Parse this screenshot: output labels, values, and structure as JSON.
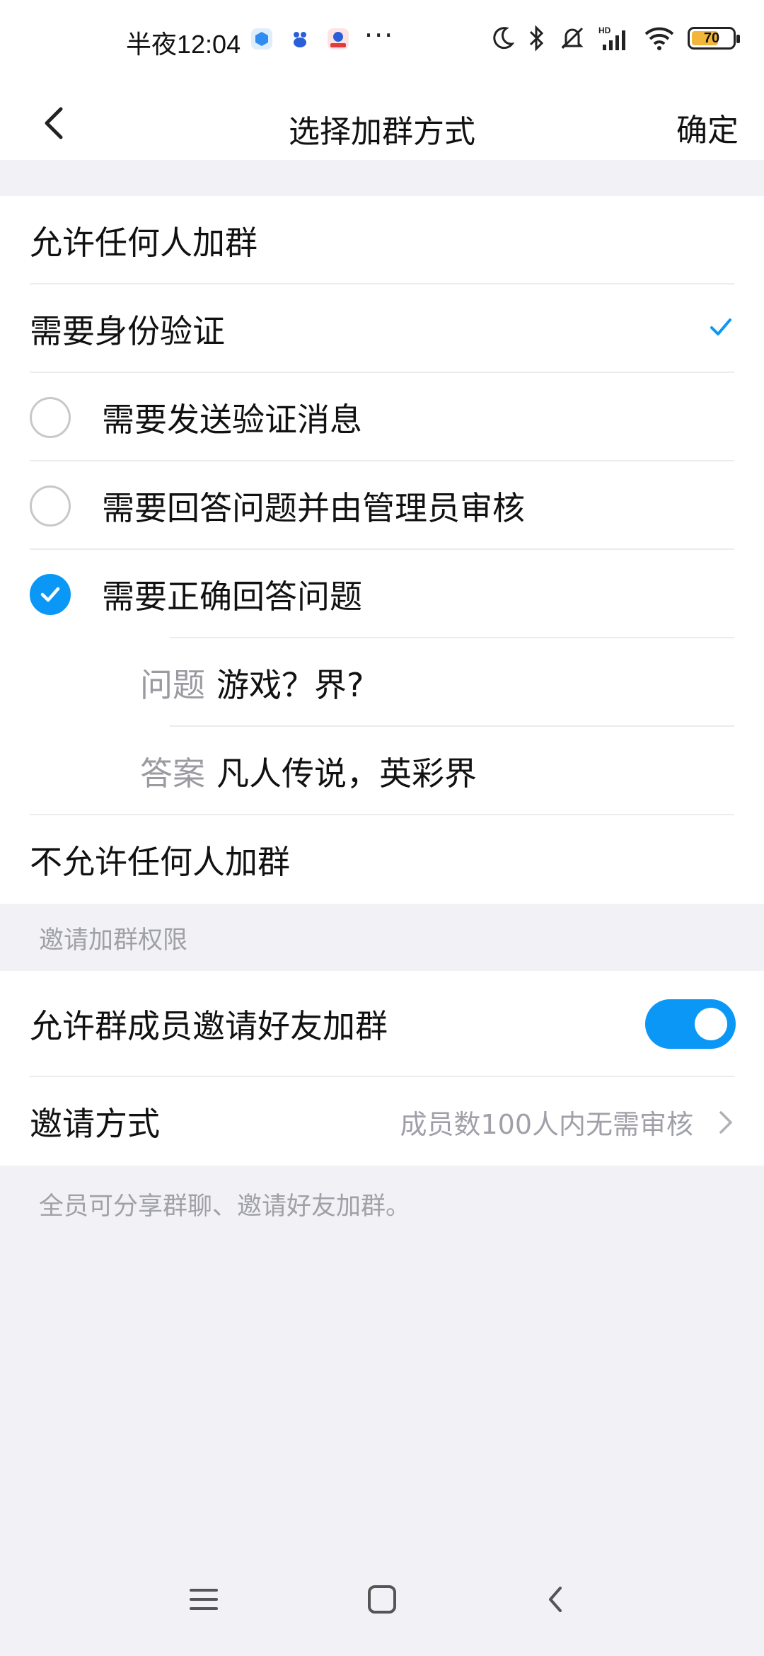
{
  "status_bar": {
    "time": "半夜12:04",
    "more": "···",
    "battery_level": 70,
    "battery_color": "#f2b73a",
    "icons": [
      "app-notification-icon-1",
      "app-notification-icon-2",
      "app-notification-icon-3",
      "moon-icon",
      "bluetooth-icon",
      "mute-bell-icon",
      "signal-icon",
      "wifi-icon",
      "battery-icon"
    ]
  },
  "nav": {
    "title": "选择加群方式",
    "confirm_label": "确定",
    "back_icon": "chevron-left-icon"
  },
  "join_options": {
    "allow_anyone": "允许任何人加群",
    "need_verification": "需要身份验证",
    "sub_options": [
      {
        "label": "需要发送验证消息",
        "selected": false
      },
      {
        "label": "需要回答问题并由管理员审核",
        "selected": false
      },
      {
        "label": "需要正确回答问题",
        "selected": true
      }
    ],
    "question_key": "问题",
    "question_value": "游戏？界?",
    "answer_key": "答案",
    "answer_value": "凡人传说，英彩界",
    "disallow_anyone": "不允许任何人加群"
  },
  "invite": {
    "header": "邀请加群权限",
    "allow_member_invite_label": "允许群成员邀请好友加群",
    "allow_member_invite_on": true,
    "method_label": "邀请方式",
    "method_value": "成员数100人内无需审核",
    "note": "全员可分享群聊、邀请好友加群。"
  },
  "colors": {
    "accent": "#0a97f5",
    "background": "#f2f2f6",
    "secondary_text": "#a0a0a8"
  }
}
